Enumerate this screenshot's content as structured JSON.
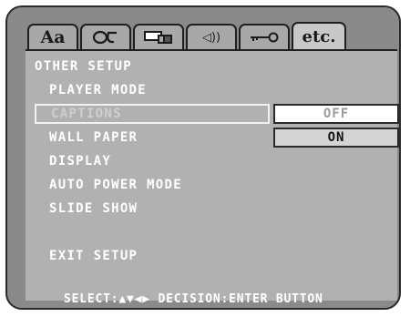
{
  "tabs": [
    {
      "label": "Aa",
      "icon": "language-icon"
    },
    {
      "label": "",
      "icon": "subtitle-icon"
    },
    {
      "label": "",
      "icon": "picture-icon"
    },
    {
      "label": "◁))",
      "icon": "audio-icon"
    },
    {
      "label": "",
      "icon": "key-icon"
    },
    {
      "label": "etc.",
      "icon": "etc-icon"
    }
  ],
  "menu": {
    "header": "OTHER SETUP",
    "items": [
      "PLAYER MODE",
      "CAPTIONS",
      "WALL PAPER",
      "DISPLAY",
      "AUTO POWER MODE",
      "SLIDE SHOW"
    ],
    "exit": "EXIT SETUP",
    "selected_index": 1
  },
  "options": {
    "off": "OFF",
    "on": "ON",
    "current": "ON"
  },
  "footer": "SELECT:▲▼◀▶ DECISION:ENTER BUTTON",
  "colors": {
    "background": "#8a8a8a",
    "panel": "#b1b1b1",
    "text": "#ffffff",
    "selected_option": "#d4d4d4"
  }
}
